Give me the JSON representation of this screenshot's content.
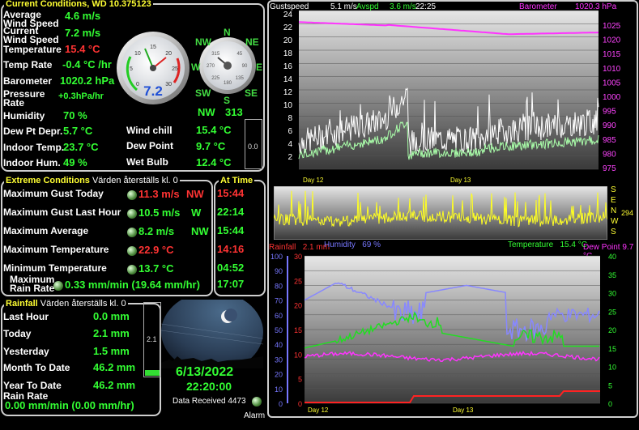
{
  "current": {
    "title": "Current Conditions, WD 10.375123",
    "avg_wind_label": "Average Wind Speed",
    "avg_wind": "4.6 m/s",
    "cur_wind_label": "Current Wind Speed",
    "cur_wind": "7.2 m/s",
    "temp_label": "Temperature",
    "temp": "15.4 °C",
    "temprate_label": "Temp Rate",
    "temprate": "-0.4 °C /hr",
    "baro_label": "Barometer",
    "baro": "1020.2 hPa",
    "prate_label": "Pressure Rate",
    "prate": "+0.3hPa/hr",
    "hum_label": "Humidity",
    "hum": "70 %",
    "dewdep_label": "Dew Pt Depr.",
    "dewdep": "5.7 °C",
    "windchill_label": "Wind chill",
    "windchill": "15.4 °C",
    "indoor_temp_label": "Indoor Temp.",
    "indoor_temp": "23.7 °C",
    "dewpoint_label": "Dew Point",
    "dewpoint": "9.7 °C",
    "indoor_hum_label": "Indoor Hum.",
    "indoor_hum": "49 %",
    "wetbulb_label": "Wet Bulb",
    "wetbulb": "12.4 °C",
    "gauge_value": "7.2",
    "gauge_ticks": [
      "0",
      "5",
      "10",
      "15",
      "20",
      "25",
      "30"
    ],
    "compass_points": [
      "N",
      "NE",
      "E",
      "SE",
      "S",
      "SW",
      "W",
      "NW"
    ],
    "compass_ticks": [
      "45",
      "90",
      "135",
      "180",
      "225",
      "270",
      "315"
    ],
    "dir_text": "NW",
    "dir_deg": "313",
    "small_box_value": "0.0"
  },
  "extreme": {
    "title": "Extreme Conditions",
    "subtitle": "Värden återställs kl. 0",
    "at_time_title": "At Time",
    "rows": [
      {
        "label": "Maximum Gust Today",
        "value": "11.3 m/s",
        "dir": "NW",
        "time": "15:44",
        "red": true
      },
      {
        "label": "Maximum Gust Last Hour",
        "value": "10.5 m/s",
        "dir": "W",
        "time": "22:14",
        "red": false
      },
      {
        "label": "Maximum Average",
        "value": "8.2 m/s",
        "dir": "NW",
        "time": "15:44",
        "red": false
      },
      {
        "label": "Maximum Temperature",
        "value": "22.9 °C",
        "dir": "",
        "time": "14:16",
        "red": true
      },
      {
        "label": "Minimum Temperature",
        "value": "13.7 °C",
        "dir": "",
        "time": "04:52",
        "red": false
      },
      {
        "label": "Maximum Rain Rate",
        "value": "0.33 mm/min (19.64 mm/hr)",
        "dir": "",
        "time": "17:07",
        "red": false
      }
    ]
  },
  "rainfall": {
    "title": "Rainfall",
    "subtitle": "Värden återställs kl. 0",
    "last_hour_label": "Last Hour",
    "last_hour": "0.0 mm",
    "today_label": "Today",
    "today": "2.1 mm",
    "yesterday_label": "Yesterday",
    "yesterday": "1.5 mm",
    "month_label": "Month To Date",
    "month": "46.2 mm",
    "year_label": "Year To Date",
    "year": "46.2 mm",
    "rate_label": "Rain Rate",
    "rate": "0.00 mm/min (0.00 mm/hr)",
    "box_value": "2.1",
    "rain_level": 0.08
  },
  "cam": {
    "date": "6/13/2022",
    "time": "22:20:00",
    "data_received": "Data Received 4473",
    "alarm": "Alarm"
  },
  "graph1": {
    "header_gust": "Gustspeed",
    "header_gust_val": "5.1 m/s",
    "header_avg": "Avspd",
    "header_avg_val": "3.6 m/s",
    "header_time": "22:25",
    "header_baro": "Barometer",
    "header_baro_val": "1020.3 hPa",
    "left_ticks": [
      "24",
      "22",
      "20",
      "18",
      "16",
      "14",
      "12",
      "10",
      "8",
      "6",
      "4",
      "2"
    ],
    "right_ticks": [
      "1025",
      "1020",
      "1015",
      "1010",
      "1005",
      "1000",
      "995",
      "990",
      "985",
      "980",
      "975"
    ],
    "day_labels": [
      "Day 12",
      "Day 13"
    ]
  },
  "graph2": {
    "dir_labels": [
      "S",
      "E",
      "N",
      "W",
      "S"
    ],
    "dir_value": "294"
  },
  "graph3": {
    "rain_label": "Rainfall",
    "rain_val": "2.1 mm",
    "hum_label": "Humidity",
    "hum_val": "69 %",
    "temp_label": "Temperature",
    "temp_val": "15.4 °C",
    "dew_label": "Dew Point",
    "dew_val": "9.7 °C",
    "left_ticks": [
      "100",
      "90",
      "80",
      "70",
      "60",
      "50",
      "40",
      "30",
      "20",
      "10",
      "0"
    ],
    "mid_ticks": [
      "30",
      "25",
      "20",
      "15",
      "10",
      "5",
      "0"
    ],
    "right_ticks": [
      "40",
      "35",
      "30",
      "25",
      "20",
      "15",
      "10",
      "5",
      "0"
    ],
    "day_labels": [
      "Day 12",
      "Day 13"
    ]
  },
  "colors": {
    "green": "#33ff33",
    "red": "#ff3333",
    "yellow": "#ffff33",
    "magenta": "#ff33ff",
    "blue": "#7777ff"
  }
}
